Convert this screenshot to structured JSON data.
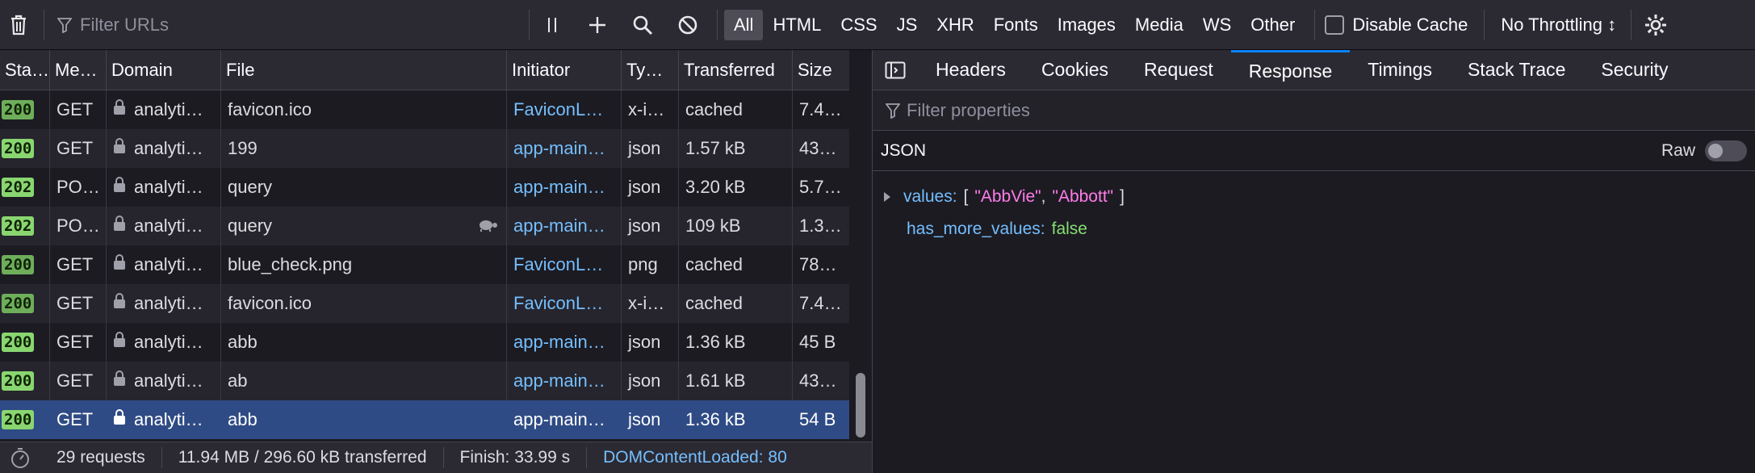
{
  "toolbar": {
    "filter_placeholder": "Filter URLs",
    "type_filters": [
      "All",
      "HTML",
      "CSS",
      "JS",
      "XHR",
      "Fonts",
      "Images",
      "Media",
      "WS",
      "Other"
    ],
    "disable_cache_label": "Disable Cache",
    "throttling_label": "No Throttling ↕"
  },
  "table": {
    "columns": [
      "Sta…",
      "Me…",
      "Domain",
      "File",
      "Initiator",
      "Ty…",
      "Transferred",
      "Size"
    ],
    "rows": [
      {
        "status": "200",
        "method": "GET",
        "domain": "analyti…",
        "file": "favicon.ico",
        "initiator": "FaviconL…",
        "type": "x-i…",
        "transferred": "cached",
        "size": "7.4…",
        "cached": true
      },
      {
        "status": "200",
        "method": "GET",
        "domain": "analyti…",
        "file": "199",
        "initiator": "app-main…",
        "type": "json",
        "transferred": "1.57 kB",
        "size": "43…",
        "cached": false
      },
      {
        "status": "202",
        "method": "PO…",
        "domain": "analyti…",
        "file": "query",
        "initiator": "app-main…",
        "type": "json",
        "transferred": "3.20 kB",
        "size": "5.7…",
        "cached": false
      },
      {
        "status": "202",
        "method": "PO…",
        "domain": "analyti…",
        "file": "query",
        "initiator": "app-main…",
        "type": "json",
        "transferred": "109 kB",
        "size": "1.3…",
        "cached": false,
        "slow": true
      },
      {
        "status": "200",
        "method": "GET",
        "domain": "analyti…",
        "file": "blue_check.png",
        "initiator": "FaviconL…",
        "type": "png",
        "transferred": "cached",
        "size": "78…",
        "cached": true
      },
      {
        "status": "200",
        "method": "GET",
        "domain": "analyti…",
        "file": "favicon.ico",
        "initiator": "FaviconL…",
        "type": "x-i…",
        "transferred": "cached",
        "size": "7.4…",
        "cached": true
      },
      {
        "status": "200",
        "method": "GET",
        "domain": "analyti…",
        "file": "abb",
        "initiator": "app-main…",
        "type": "json",
        "transferred": "1.36 kB",
        "size": "45 B",
        "cached": false
      },
      {
        "status": "200",
        "method": "GET",
        "domain": "analyti…",
        "file": "ab",
        "initiator": "app-main…",
        "type": "json",
        "transferred": "1.61 kB",
        "size": "43…",
        "cached": false
      },
      {
        "status": "200",
        "method": "GET",
        "domain": "analyti…",
        "file": "abb",
        "initiator": "app-main…",
        "type": "json",
        "transferred": "1.36 kB",
        "size": "54 B",
        "cached": false,
        "selected": true
      }
    ]
  },
  "statusbar": {
    "requests": "29 requests",
    "transferred": "11.94 MB / 296.60 kB transferred",
    "finish": "Finish: 33.99 s",
    "dcl": "DOMContentLoaded: 80"
  },
  "details": {
    "tabs": [
      "Headers",
      "Cookies",
      "Request",
      "Response",
      "Timings",
      "Stack Trace",
      "Security"
    ],
    "active_tab": "Response",
    "filter_placeholder": "Filter properties",
    "section_label": "JSON",
    "raw_label": "Raw",
    "json": {
      "values_key": "values:",
      "values_open": "[",
      "value_1": "\"AbbVie\"",
      "comma": ",",
      "value_2": "\"Abbott\"",
      "values_close": "]",
      "has_more_key": "has_more_values:",
      "has_more_value": "false"
    }
  }
}
